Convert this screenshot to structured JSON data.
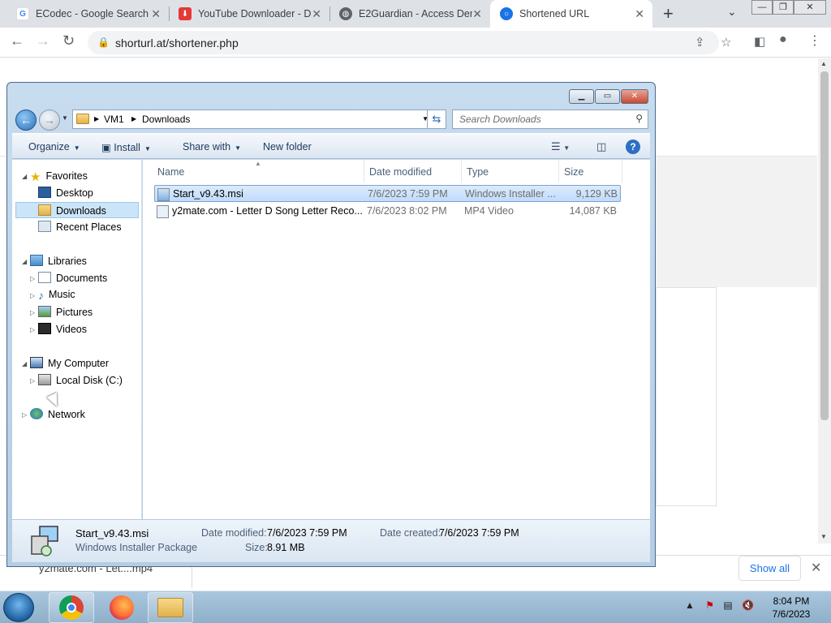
{
  "browser": {
    "tabs": [
      {
        "title": "ECodec - Google Search",
        "favicon": "google-g-icon",
        "color": "#4285f4"
      },
      {
        "title": "YouTube Downloader - D",
        "favicon": "download-icon",
        "color": "#e53935"
      },
      {
        "title": "E2Guardian - Access Den",
        "favicon": "globe-icon",
        "color": "#5f6368"
      },
      {
        "title": "Shortened URL",
        "favicon": "shorturl-icon",
        "color": "#1a73e8"
      }
    ],
    "url": "shorturl.at/shortener.php"
  },
  "explorer": {
    "breadcrumb": [
      "VM1",
      "Downloads"
    ],
    "search_placeholder": "Search Downloads",
    "commands": {
      "organize": "Organize",
      "install": "Install",
      "share_with": "Share with",
      "new_folder": "New folder"
    },
    "nav": {
      "favorites": "Favorites",
      "desktop": "Desktop",
      "downloads": "Downloads",
      "recent_places": "Recent Places",
      "libraries": "Libraries",
      "documents": "Documents",
      "music": "Music",
      "pictures": "Pictures",
      "videos": "Videos",
      "my_computer": "My Computer",
      "local_disk": "Local Disk (C:)",
      "network": "Network"
    },
    "columns": {
      "name": "Name",
      "date_modified": "Date modified",
      "type": "Type",
      "size": "Size"
    },
    "files": [
      {
        "name": "Start_v9.43.msi",
        "date": "7/6/2023 7:59 PM",
        "type": "Windows Installer ...",
        "size": "9,129 KB"
      },
      {
        "name": "y2mate.com - Letter D Song  Letter Reco...",
        "date": "7/6/2023 8:02 PM",
        "type": "MP4 Video",
        "size": "14,087 KB"
      }
    ],
    "details": {
      "name": "Start_v9.43.msi",
      "kind": "Windows Installer Package",
      "date_modified_label": "Date modified:",
      "date_modified": "7/6/2023 7:59 PM",
      "date_created_label": "Date created:",
      "date_created": "7/6/2023 7:59 PM",
      "size_label": "Size:",
      "size": "8.91 MB"
    }
  },
  "shelf": {
    "item": "y2mate.com - Let....mp4",
    "show_all": "Show all"
  },
  "taskbar": {
    "time": "8:04 PM",
    "date": "7/6/2023"
  }
}
